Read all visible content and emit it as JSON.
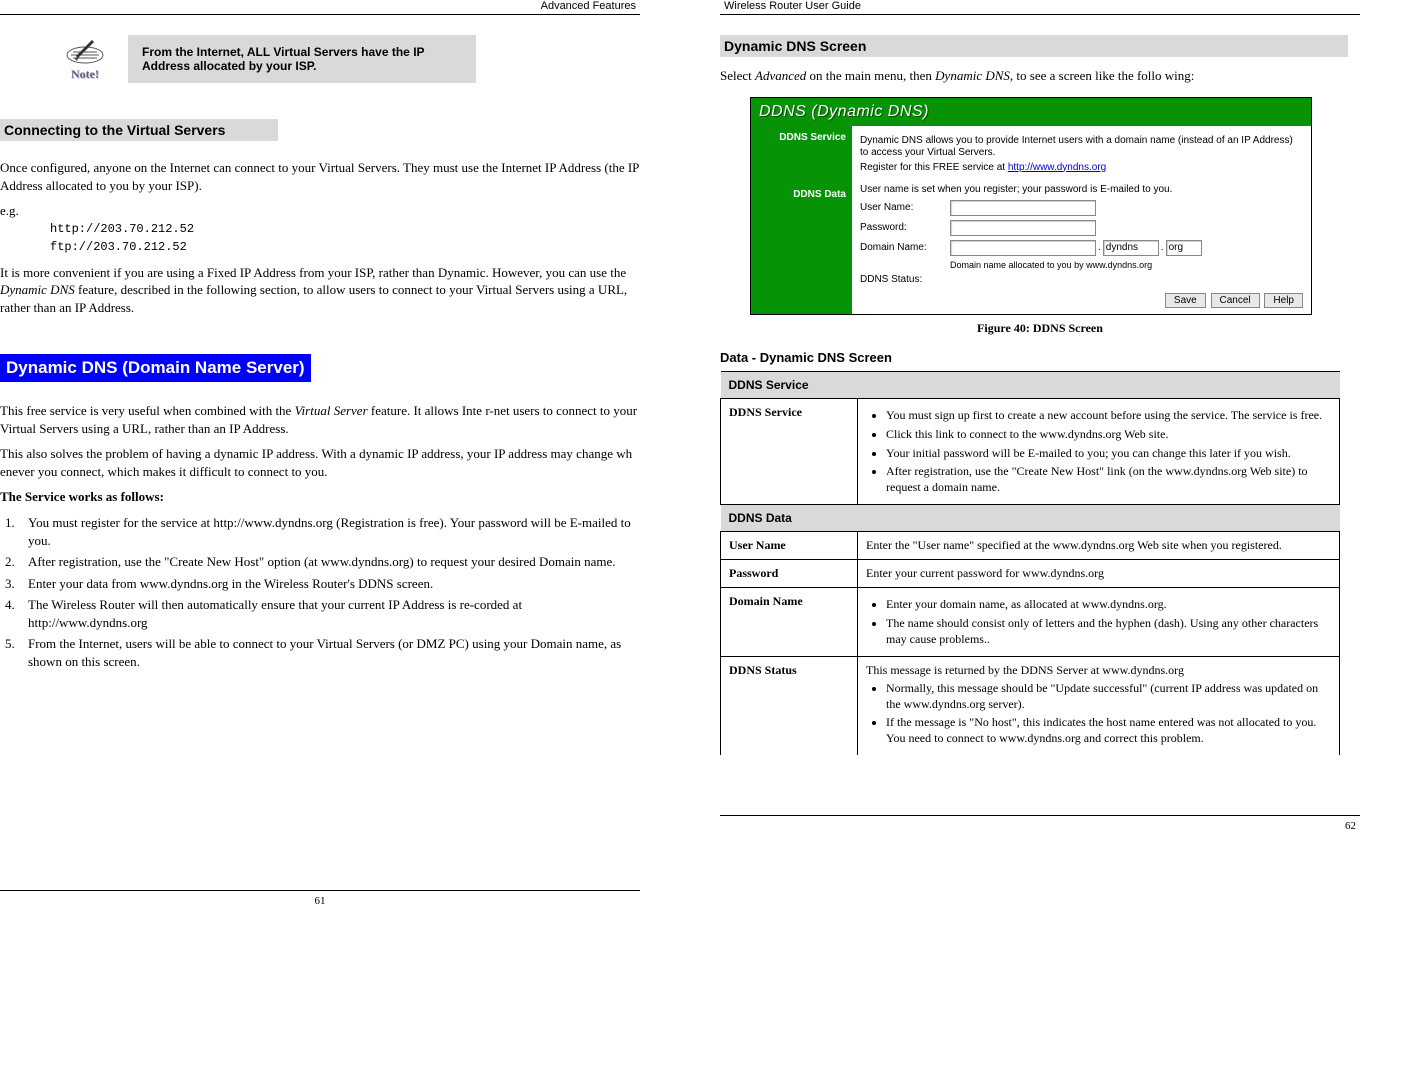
{
  "left": {
    "header": "Advanced Features",
    "note": {
      "label": "Note!",
      "text": "From the Internet, ALL Virtual Servers have the IP Address allocated by your ISP."
    },
    "h1": "Connecting to the Virtual Servers",
    "p1": "Once configured, anyone on the Internet can connect to your Virtual Servers. They must use the Internet IP Address (the IP Address allocated to you by your ISP).",
    "eg_label": "e.g.",
    "mono1": "http://203.70.212.52",
    "mono2": "ftp://203.70.212.52",
    "p2a": "It is more convenient if you are using a Fixed IP Address from your ISP, rather than Dynamic. However, you can use the ",
    "p2b": "Dynamic DNS",
    "p2c": " feature, described in the following section, to allow users to connect to your Virtual Servers using a URL, rather than an IP Address.",
    "h2": "Dynamic DNS (Domain Name Server)",
    "p3a": "This free service is very useful when combined with the ",
    "p3b": "Virtual Server",
    "p3c": " feature. It allows Inte r-net users to connect to your Virtual Servers using a URL, rather than an IP Address.",
    "p4": "This also solves the problem of having a dynamic IP address. With a dynamic IP address, your IP address may change wh enever you connect, which makes it difficult to connect to you.",
    "p5": "The Service works as follows:",
    "ol": [
      "You must register for the service at http://www.dyndns.org (Registration is free). Your password will be E-mailed to you.",
      "After registration, use the \"Create New Host\" option (at www.dyndns.org) to request your desired Domain name.",
      "Enter your data from www.dyndns.org in the Wireless Router's DDNS screen.",
      "The Wireless Router will then automatically ensure that your current IP Address is re-corded at http://www.dyndns.org",
      "From the Internet, users will be able to connect to your Virtual Servers (or DMZ PC) using your Domain name, as shown on this screen."
    ],
    "page_num": "61"
  },
  "right": {
    "header": "Wireless Router User Guide",
    "h1": "Dynamic DNS Screen",
    "p1a": "Select ",
    "p1b": "Advanced",
    "p1c": " on the main menu, then ",
    "p1d": "Dynamic DNS",
    "p1e": ", to see a screen like the follo wing:",
    "fig": {
      "title": "DDNS (Dynamic DNS)",
      "side1": "DDNS Service",
      "side2": "DDNS Data",
      "desc1": "Dynamic DNS allows you to provide Internet users with a domain name (instead of an IP Address) to access your Virtual Servers.",
      "desc2a": "Register for this FREE service at ",
      "desc2b": "http://www.dyndns.org",
      "desc3": "User name is set when you register; your password is E-mailed to you.",
      "row_user": "User Name:",
      "row_pass": "Password:",
      "row_domain": "Domain Name:",
      "domain_seg2": "dyndns",
      "domain_seg3": "org",
      "domain_note": "Domain name allocated to you by www.dyndns.org",
      "row_status": "DDNS Status:",
      "btn_save": "Save",
      "btn_cancel": "Cancel",
      "btn_help": "Help"
    },
    "fig_caption": "Figure 40: DDNS Screen",
    "h2": "Data - Dynamic DNS Screen",
    "table": {
      "sec1": "DDNS Service",
      "row1_label": "DDNS Service",
      "row1_items": [
        "You must sign up first to create a new account before using the service. The service is free.",
        "Click this link to connect to the www.dyndns.org Web site.",
        "Your initial password will be E-mailed to you; you can change this later if you wish.",
        "After registration, use the \"Create New Host\" link (on the www.dyndns.org Web site) to request a domain name."
      ],
      "sec2": "DDNS Data",
      "row2_label": "User Name",
      "row2_text": "Enter the \"User name\" specified at the www.dyndns.org Web site when you registered.",
      "row3_label": "Password",
      "row3_text": "Enter your current password for www.dyndns.org",
      "row4_label": "Domain Name",
      "row4_items": [
        "Enter your domain name, as allocated at www.dyndns.org.",
        "The name should consist only of letters and the hyphen (dash). Using any other characters may cause problems.."
      ],
      "row5_label": "DDNS Status",
      "row5_text": "This message is returned by the DDNS Server at www.dyndns.org",
      "row5_items": [
        "Normally, this message should be \"Update successful\" (current IP address was updated on the www.dyndns.org server).",
        "If the message is \"No host\", this indicates the host name entered was not allocated to you. You need to connect to www.dyndns.org and correct this problem."
      ]
    },
    "page_num": "62"
  }
}
